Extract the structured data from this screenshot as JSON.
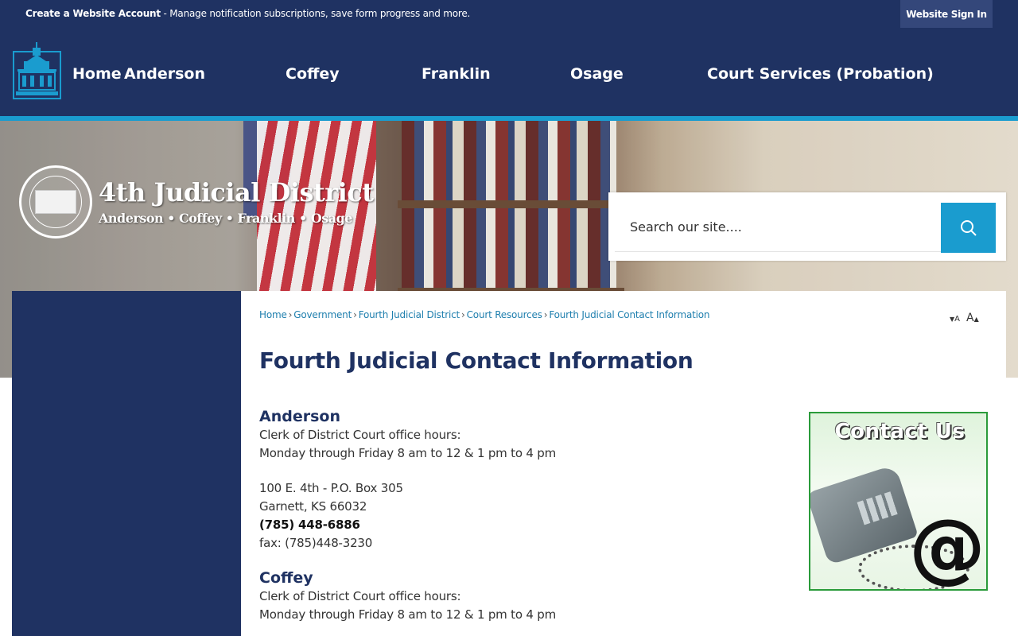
{
  "top_strip": {
    "create_account_label": "Create a Website Account",
    "create_account_desc": " - Manage notification subscriptions, save form progress and more.",
    "signin_label": "Website Sign In"
  },
  "nav": {
    "items": [
      "Home",
      "Anderson",
      "Coffey",
      "Franklin",
      "Osage",
      "Court Services (Probation)"
    ]
  },
  "banner": {
    "title": "4th Judicial District",
    "subtitle": "Anderson • Coffey • Franklin • Osage"
  },
  "search": {
    "placeholder": "Search our site...."
  },
  "breadcrumb": {
    "items": [
      "Home",
      "Government",
      "Fourth Judicial District",
      "Court Resources",
      "Fourth Judicial Contact Information"
    ],
    "separator": "›"
  },
  "font_size": {
    "decrease_label": "A",
    "increase_label": "A"
  },
  "page": {
    "title": "Fourth Judicial Contact Information"
  },
  "counties": [
    {
      "name": "Anderson",
      "hours_label": "Clerk of District Court office hours:",
      "hours": "Monday through Friday 8 am to 12 & 1 pm to 4 pm",
      "address1": "100 E. 4th - P.O. Box 305",
      "address2": "Garnett, KS 66032",
      "phone": "(785) 448-6886",
      "fax": "fax: (785)448-3230"
    },
    {
      "name": "Coffey",
      "hours_label": "Clerk of District Court office hours:",
      "hours": "Monday through Friday 8 am to 12 & 1 pm to 4 pm"
    }
  ],
  "contact_image": {
    "caption": "Contact Us",
    "symbol": "@"
  },
  "colors": {
    "navy": "#1f3262",
    "accent_blue": "#1a9ccf",
    "link": "#1f7fae"
  }
}
